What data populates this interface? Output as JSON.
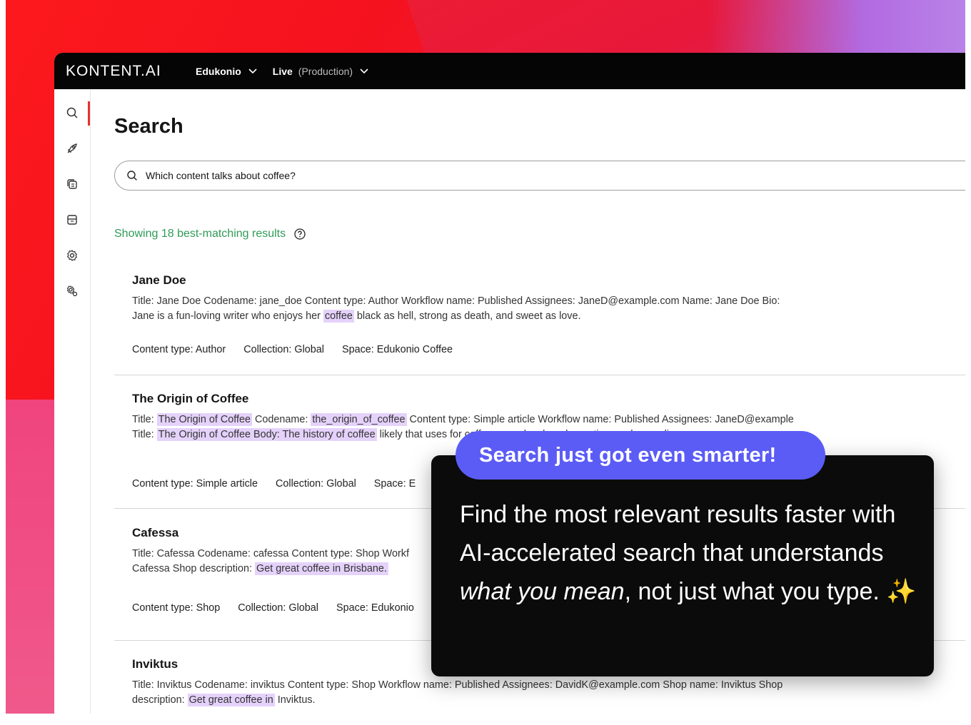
{
  "topbar": {
    "logo": "KONTENT.AI",
    "project": "Edukonio",
    "environment": "Live",
    "environment_sub": "(Production)"
  },
  "sidebar": {
    "items": [
      "search-icon",
      "rocket-icon",
      "content-icon",
      "assets-icon",
      "settings-icon",
      "project-settings-icon"
    ]
  },
  "page": {
    "title": "Search",
    "search_value": "Which content talks about coffee?",
    "results_count": "Showing 18 best-matching results"
  },
  "results": [
    {
      "title": "Jane Doe",
      "desc_parts": [
        {
          "t": "Title: Jane Doe Codename: jane_doe Content type: Author Workflow name: Published Assignees: JaneD@example.com Name: Jane Doe Bio: Jane is a fun-loving writer who enjoys her ",
          "hl": false
        },
        {
          "t": "coffee",
          "hl": true
        },
        {
          "t": " black as hell, strong as death, and sweet as love.",
          "hl": false
        }
      ],
      "meta": [
        "Content type: Author",
        "Collection: Global",
        "Space: Edukonio Coffee"
      ]
    },
    {
      "title": "The Origin of Coffee",
      "desc_parts": [
        {
          "t": "Title: ",
          "hl": false
        },
        {
          "t": "The Origin of Coffee",
          "hl": true
        },
        {
          "t": " Codename: ",
          "hl": false
        },
        {
          "t": "the_origin_of_coffee",
          "hl": true
        },
        {
          "t": " Content type: Simple article Workflow name: Published Assignees: JaneD@example Title: ",
          "hl": false
        },
        {
          "t": "The Origin of Coffee Body: The history of coffee",
          "hl": true
        },
        {
          "t": " likely that uses for coffee were developed over time and were disc",
          "hl": false
        }
      ],
      "meta": [
        "Content type: Simple article",
        "Collection: Global",
        "Space: E"
      ]
    },
    {
      "title": "Cafessa",
      "desc_parts": [
        {
          "t": "Title: Cafessa Codename: cafessa Content type: Shop Workf Cafessa Shop description: ",
          "hl": false
        },
        {
          "t": "Get great coffee in Brisbane.",
          "hl": true
        }
      ],
      "meta": [
        "Content type: Shop",
        "Collection: Global",
        "Space: Edukonio"
      ]
    },
    {
      "title": "Inviktus",
      "desc_parts": [
        {
          "t": "Title: Inviktus Codename: inviktus Content type: Shop Workflow name: Published Assignees: DavidK@example.com Shop name: Inviktus Shop description: ",
          "hl": false
        },
        {
          "t": "Get great coffee in",
          "hl": true
        },
        {
          "t": " Inviktus.",
          "hl": false
        }
      ],
      "meta": []
    }
  ],
  "popup": {
    "headline": "Search just got even smarter!",
    "body_1": "Find the most relevant results faster with AI-accelerated search that understands ",
    "body_em": "what you mean",
    "body_2": ", not just what you type. ",
    "sparkle": "✨"
  },
  "colors": {
    "accent": "#5b5cf6",
    "highlight": "#e5d2fb",
    "results_green": "#2e9b57",
    "active_red": "#e5322d"
  }
}
